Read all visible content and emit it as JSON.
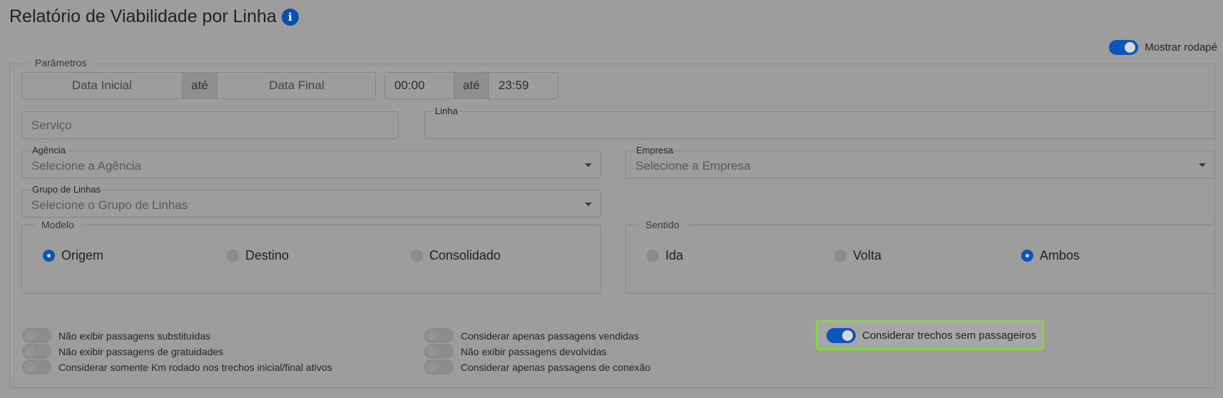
{
  "title": "Relatório de Viabilidade por Linha",
  "info_icon_glyph": "i",
  "footer_toggle": {
    "label": "Mostrar rodapé",
    "on": true
  },
  "params_legend": "Parâmetros",
  "date_range": {
    "start": "Data Inicial",
    "separator": "até",
    "end": "Data Final"
  },
  "time_range": {
    "start": "00:00",
    "separator": "até",
    "end": "23:59"
  },
  "servico": {
    "placeholder": "Serviço"
  },
  "linha": {
    "label": "Linha",
    "value": ""
  },
  "agencia": {
    "label": "Agência",
    "placeholder": "Selecione a Agência"
  },
  "empresa": {
    "label": "Empresa",
    "placeholder": "Selecione a Empresa"
  },
  "grupo_linhas": {
    "label": "Grupo de Linhas",
    "placeholder": "Selecione o Grupo de Linhas"
  },
  "modelo": {
    "legend": "Modelo",
    "options": [
      "Origem",
      "Destino",
      "Consolidado"
    ],
    "selected": "Origem"
  },
  "sentido": {
    "legend": "Sentido",
    "options": [
      "Ida",
      "Volta",
      "Ambos"
    ],
    "selected": "Ambos"
  },
  "switches_col1": [
    "Não exibir passagens substituídas",
    "Não exibir passagens de gratuidades",
    "Considerar somente Km rodado nos trechos inicial/final ativos"
  ],
  "switches_col2": [
    "Considerar apenas passagens vendidas",
    "Não exibir passagens devolvidas",
    "Considerar apenas passagens de conexão"
  ],
  "highlighted_switch": {
    "label": "Considerar trechos sem passageiros",
    "on": true
  },
  "colors": {
    "accent": "#0b56b8",
    "highlight": "#8ad04a",
    "overlay": "#9d9d9d"
  }
}
